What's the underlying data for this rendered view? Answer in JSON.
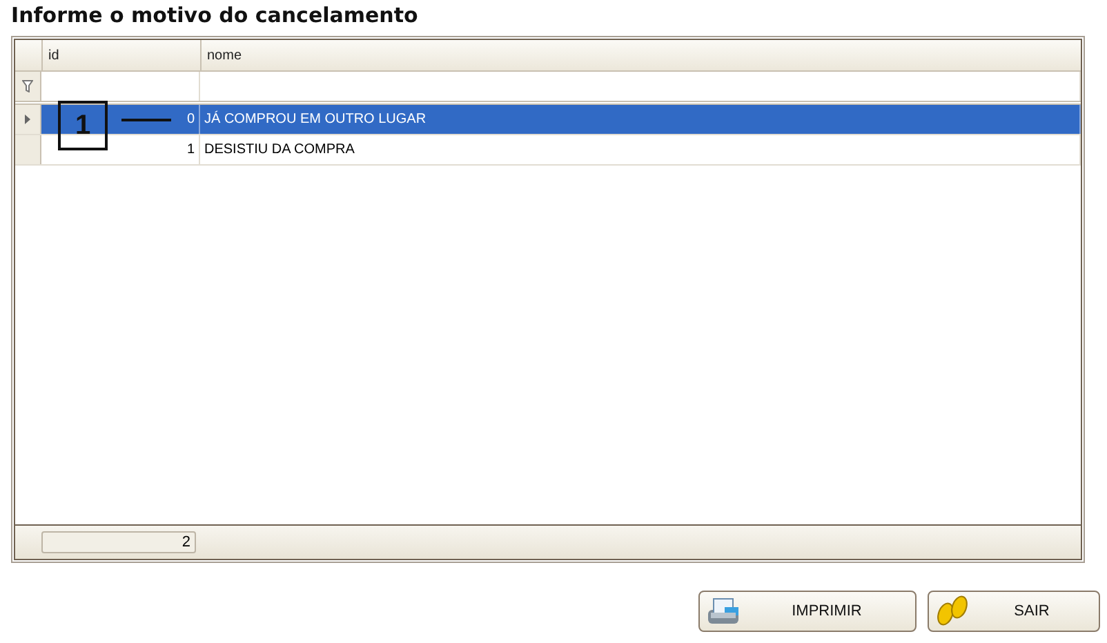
{
  "title": "Informe o motivo do cancelamento",
  "table": {
    "columns": [
      "id",
      "nome"
    ],
    "rows": [
      {
        "id": "0",
        "nome": "JÁ COMPROU EM OUTRO LUGAR",
        "selected": true
      },
      {
        "id": "1",
        "nome": "DESISTIU DA COMPRA",
        "selected": false
      }
    ],
    "footer_count": "2"
  },
  "callout": {
    "label": "1"
  },
  "buttons": [
    {
      "kind": "print",
      "label": "IMPRIMIR"
    },
    {
      "kind": "exit",
      "label": "SAIR"
    }
  ]
}
